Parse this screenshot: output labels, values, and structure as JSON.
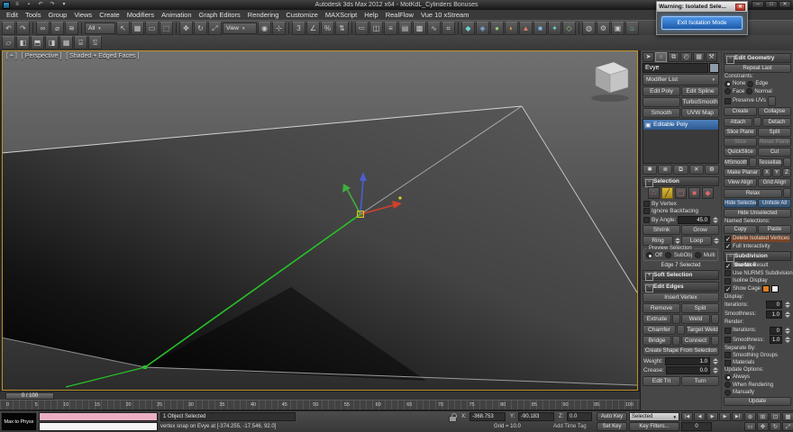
{
  "title_bar": {
    "app_menu": "≡",
    "save": "▪",
    "undo": "↶",
    "redo": "↷",
    "workspace_arrow": "▾",
    "app_title": "Autodesk 3ds Max 2012 x64 - MotKdL_Cylinders Bonuses",
    "min": "─",
    "max": "□",
    "close": "✕"
  },
  "warning_dialog": {
    "title": "Warning: Isolated Sele...",
    "close": "✕",
    "button_label": "Exit Isolation Mode"
  },
  "menu_bar": {
    "items": [
      "Edit",
      "Tools",
      "Group",
      "Views",
      "Create",
      "Modifiers",
      "Animation",
      "Graph Editors",
      "Rendering",
      "Customize",
      "MAXScript",
      "Help",
      "RealFlow",
      "Vue 10 xStream"
    ]
  },
  "toolbar": {
    "icons": {
      "undo": "↶",
      "redo": "↷",
      "select_link": "∞",
      "unlink": "⌀",
      "bind_spacewarp": "≋",
      "select_object": "↖",
      "select_by_name": "▦",
      "rect_region": "▭",
      "window_crossing": "⬚",
      "move": "✥",
      "rotate": "↻",
      "scale": "⤢",
      "pivot_center": "◉",
      "manipulate": "⊹",
      "snap3d": "3",
      "angle_snap": "∠",
      "percent_snap": "%",
      "spinner_snap": "⇅",
      "named_sets": "≔",
      "mirror": "◫",
      "align": "≡",
      "layers": "▤",
      "graphite": "▩",
      "curve_editor": "∿",
      "schematic": "⌗",
      "material_editor": "◍",
      "render_setup": "⚙",
      "rendered_frame": "▣",
      "render": "♨"
    },
    "selection_filter_value": "All",
    "coord_system_value": "View",
    "dropdown_arrow": "▼",
    "plugin_icons": [
      "◆",
      "◈",
      "●",
      "◐",
      "▲",
      "■",
      "✦",
      "◇"
    ]
  },
  "toolbar2": {
    "icons": [
      "▱",
      "◧",
      "⬒",
      "◨",
      "▦",
      "⌸",
      "⍂"
    ]
  },
  "viewport": {
    "label_plus": "[ + ]",
    "label_view": "[ Perspective ]",
    "label_shading": "[ Shaded + Edged Faces ]"
  },
  "command_panel": {
    "tabs": {
      "create": "➤",
      "modify": "∩",
      "hierarchy": "⧉",
      "motion": "◴",
      "display": "▦",
      "utilities": "⚒"
    },
    "object_name": "Evye",
    "modifier_list_label": "Modifier List",
    "modifier_buttons": [
      [
        "Edit Poly",
        "Edit Spline"
      ],
      [
        "",
        "TurboSmooth"
      ],
      [
        "Smooth",
        "UVW Map"
      ]
    ],
    "stack_item": "Editable Poly",
    "stack_item_icon": "▣",
    "stack_tools": {
      "pin": "✱",
      "show_end": "≣",
      "unique": "⧉",
      "remove": "✕",
      "configure": "⚙"
    },
    "selection": {
      "header": "Selection",
      "subobj": {
        "vertex": "∴",
        "edge": "╱",
        "border": "▢",
        "polygon": "■",
        "element": "◆"
      },
      "by_vertex": "By Vertex",
      "ignore_backfacing": "Ignore Backfacing",
      "by_angle": "By Angle:",
      "by_angle_value": "45.0",
      "shrink": "Shrink",
      "grow": "Grow",
      "ring": "Ring",
      "loop": "Loop",
      "preview_label": "Preview Selection",
      "preview_off": "Off",
      "preview_subobj": "SubObj",
      "preview_multi": "Multi",
      "status": "Edge 7 Selected"
    },
    "soft_selection_header": "Soft Selection",
    "edit_edges": {
      "header": "Edit Edges",
      "insert_vertex": "Insert Vertex",
      "remove": "Remove",
      "split": "Split",
      "extrude": "Extrude",
      "weld": "Weld",
      "chamfer": "Chamfer",
      "target_weld": "Target Weld",
      "bridge": "Bridge",
      "connect": "Connect",
      "create_shape": "Create Shape From Selection",
      "weight_label": "Weight:",
      "weight_value": "1.0",
      "crease_label": "Crease:",
      "crease_value": "0.0",
      "edit_tri": "Edit Tri",
      "turn": "Turn"
    }
  },
  "edit_geometry": {
    "header": "Edit Geometry",
    "repeat_last": "Repeat Last",
    "constraints_label": "Constraints:",
    "constraint_none": "None",
    "constraint_edge": "Edge",
    "constraint_face": "Face",
    "constraint_normal": "Normal",
    "preserve_uvs": "Preserve UVs",
    "create": "Create",
    "collapse": "Collapse",
    "attach": "Attach",
    "detach": "Detach",
    "slice_plane": "Slice Plane",
    "split": "Split",
    "slice": "Slice",
    "reset_plane": "Reset Plane",
    "quickslice": "QuickSlice",
    "cut": "Cut",
    "msmooth": "MSmooth",
    "tessellate": "Tessellate",
    "make_planar": "Make Planar",
    "x": "X",
    "y": "Y",
    "z": "Z",
    "view_align": "View Align",
    "grid_align": "Grid Align",
    "relax": "Relax",
    "hide_selected": "Hide Selected",
    "unhide_all": "Unhide All",
    "hide_unselected": "Hide Unselected",
    "named_selections": "Named Selections:",
    "copy": "Copy",
    "paste": "Paste",
    "delete_isolated": "Delete Isolated Vertices",
    "full_interactivity": "Full Interactivity"
  },
  "subdivision_surface": {
    "header": "Subdivision Surface",
    "smooth_result": "Smooth Result",
    "use_nurms": "Use NURMS Subdivision",
    "isoline_display": "Isoline Display",
    "show_cage": "Show Cage",
    "display_label": "Display:",
    "iterations_label": "Iterations:",
    "smoothness_label": "Smoothness:",
    "display_iterations": "0",
    "display_smoothness": "1.0",
    "render_label": "Render:",
    "render_iterations": "0",
    "render_smoothness": "1.0",
    "separate_by_label": "Separate By:",
    "smoothing_groups": "Smoothing Groups",
    "materials": "Materials",
    "update_options_label": "Update Options:",
    "always": "Always",
    "when_rendering": "When Rendering",
    "manually": "Manually",
    "update": "Update"
  },
  "timeline": {
    "slider_label": "0 / 100",
    "ticks": [
      "0",
      "5",
      "10",
      "15",
      "20",
      "25",
      "30",
      "35",
      "40",
      "45",
      "50",
      "55",
      "60",
      "65",
      "70",
      "75",
      "80",
      "85",
      "90",
      "95",
      "100"
    ]
  },
  "status_bar": {
    "maxscript_button": "Max to Physx",
    "selection_status": "1 Object Selected",
    "prompt": "vertex snap on Evye at [-374.255, -17.546, 92.0]",
    "x_label": "X:",
    "x_value": "-368.753",
    "y_label": "Y:",
    "y_value": "-90.183",
    "z_label": "Z:",
    "z_value": "0.0",
    "grid_status": "Grid = 10.0",
    "add_time_tag": "Add Time Tag",
    "auto_key": "Auto Key",
    "selected_dropdown": "Selected",
    "set_key": "Set Key",
    "key_filters": "Key Filters...",
    "frame_value": "0",
    "transport": {
      "start": "|◀",
      "prev": "◀",
      "play": "▶",
      "next": "▶",
      "end": "▶|"
    },
    "nav": {
      "zoom": "⊕",
      "zoom_all": "⊞",
      "zoom_ext": "⊡",
      "zoom_ext_all": "▦",
      "region": "▭",
      "pan": "✥",
      "orbit": "↻",
      "maximize": "⤢"
    }
  }
}
